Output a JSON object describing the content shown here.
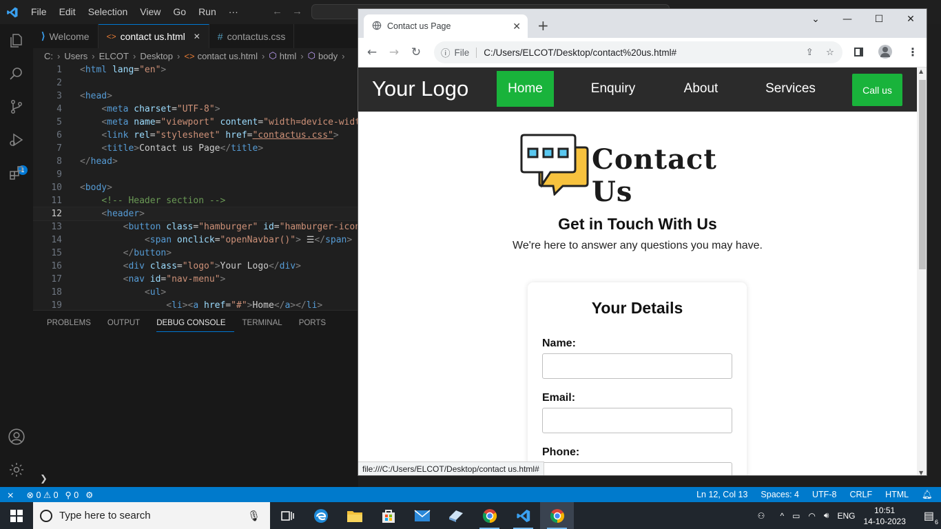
{
  "vscode": {
    "menu": [
      "File",
      "Edit",
      "Selection",
      "View",
      "Go",
      "Run",
      "···"
    ],
    "tabs": [
      {
        "label": "Welcome",
        "icon": "vscode-icon"
      },
      {
        "label": "contact us.html",
        "icon": "html-icon",
        "close": "✕"
      },
      {
        "label": "contactus.css",
        "icon": "css-icon"
      }
    ],
    "breadcrumb": [
      "C:",
      "Users",
      "ELCOT",
      "Desktop",
      "contact us.html",
      "html",
      "body"
    ],
    "code_lines": [
      {
        "n": "1"
      },
      {
        "n": "2"
      },
      {
        "n": "3"
      },
      {
        "n": "4"
      },
      {
        "n": "5"
      },
      {
        "n": "6"
      },
      {
        "n": "7"
      },
      {
        "n": "8"
      },
      {
        "n": "9"
      },
      {
        "n": "10"
      },
      {
        "n": "11"
      },
      {
        "n": "12"
      },
      {
        "n": "13"
      },
      {
        "n": "14"
      },
      {
        "n": "15"
      },
      {
        "n": "16"
      },
      {
        "n": "17"
      },
      {
        "n": "18"
      },
      {
        "n": "19"
      }
    ],
    "code": {
      "l1_tag": "html",
      "l1_attr": "lang",
      "l1_val": "\"en\"",
      "l3_tag": "head",
      "l4_tag": "meta",
      "l4_attr": "charset",
      "l4_val": "\"UTF-8\"",
      "l5_tag": "meta",
      "l5_attr1": "name",
      "l5_val1": "\"viewport\"",
      "l5_attr2": "content",
      "l5_val2": "\"width=device-width",
      "l6_tag": "link",
      "l6_attr1": "rel",
      "l6_val1": "\"stylesheet\"",
      "l6_attr2": "href",
      "l6_val2": "\"contactus.css\"",
      "l7_tag": "title",
      "l7_text": "Contact us Page",
      "l8_tag": "head",
      "l10_tag": "body",
      "l11_comment": "<!-- Header section -->",
      "l12_tag": "header",
      "l13_tag": "button",
      "l13_attr1": "class",
      "l13_val1": "\"hamburger\"",
      "l13_attr2": "id",
      "l13_val2": "\"hamburger-icon",
      "l14_tag": "span",
      "l14_attr": "onclick",
      "l14_val": "\"openNavbar()\"",
      "l14_text": " ☰",
      "l15_tag": "button",
      "l16_tag": "div",
      "l16_attr": "class",
      "l16_val": "\"logo\"",
      "l16_text": "Your Logo",
      "l17_tag": "nav",
      "l17_attr": "id",
      "l17_val": "\"nav-menu\"",
      "l18_tag": "ul",
      "l19_tag1": "li",
      "l19_tag2": "a",
      "l19_attr": "href",
      "l19_val": "\"#\"",
      "l19_text": "Home"
    },
    "panel_tabs": [
      "PROBLEMS",
      "OUTPUT",
      "DEBUG CONSOLE",
      "TERMINAL",
      "PORTS"
    ],
    "panel_prompt": "❯",
    "debug_badge": "1",
    "status_left": {
      "errors": "0",
      "warnings": "0",
      "ports": "0"
    },
    "status_right": [
      "Ln 12, Col 13",
      "Spaces: 4",
      "UTF-8",
      "CRLF",
      "HTML"
    ]
  },
  "chrome": {
    "tab_title": "Contact us Page",
    "tab_close": "✕",
    "new_tab": "+",
    "url_scheme": "File",
    "url": "C:/Users/ELCOT/Desktop/contact%20us.html#",
    "hover_url": "file:///C:/Users/ELCOT/Desktop/contact us.html#"
  },
  "site": {
    "logo": "Your Logo",
    "nav": [
      "Home",
      "Enquiry",
      "About",
      "Services"
    ],
    "call": "Call us",
    "banner_title": "Contact Us",
    "heading": "Get in Touch With Us",
    "subheading": "We're here to answer any questions you may have.",
    "form_title": "Your Details",
    "fields": [
      "Name:",
      "Email:",
      "Phone:"
    ]
  },
  "taskbar": {
    "search_placeholder": "Type here to search",
    "language": "ENG",
    "time": "10:51",
    "date": "14-10-2023",
    "notifications": "6"
  },
  "colors": {
    "vscode_accent": "#007acc",
    "site_green": "#19b33b",
    "site_header": "#2b2b2b"
  }
}
